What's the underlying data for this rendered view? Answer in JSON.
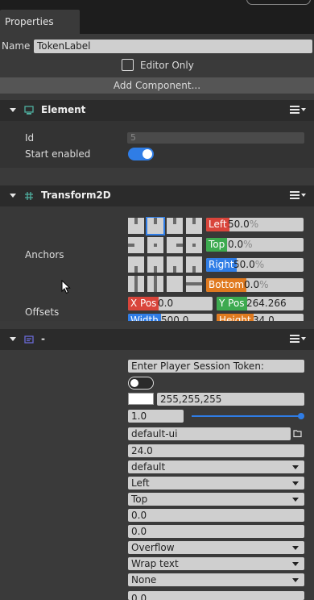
{
  "tab": {
    "label": "Properties"
  },
  "top": {
    "name_label": "Name",
    "name_value": "TokenLabel",
    "editor_only_label": "Editor Only",
    "add_component_label": "Add Component..."
  },
  "element": {
    "title": "Element",
    "id_label": "Id",
    "id_value": "5",
    "start_enabled_label": "Start enabled"
  },
  "transform": {
    "title": "Transform2D",
    "anchors_label": "Anchors",
    "offsets_label": "Offsets",
    "left_tag": "Left",
    "left_value": "50.0",
    "left_unit": "%",
    "top_tag": "Top",
    "top_value": "0.0",
    "top_unit": "%",
    "right_tag": "Right",
    "right_value": "50.0",
    "right_unit": "%",
    "bottom_tag": "Bottom",
    "bottom_value": "0.0",
    "bottom_unit": "%",
    "xpos_tag": "X Pos",
    "xpos_value": "0.0",
    "ypos_tag": "Y Pos",
    "ypos_value": "264.266",
    "width_tag": "Width",
    "width_value": "500.0",
    "height_tag": "Height",
    "height_value": "34.0"
  },
  "text_component": {
    "title": "-",
    "text_value": "Enter Player Session Token:",
    "color_value": "255,255,255",
    "opacity_value": "1.0",
    "opacity_level": 1.0,
    "font_value": "default-ui",
    "font_size_value": "24.0",
    "font_effect_value": "default",
    "h_align_value": "Left",
    "v_align_value": "Top",
    "char_spacing_value": "0.0",
    "line_spacing_value": "0.0",
    "overflow_value": "Overflow",
    "wrap_value": "Wrap text",
    "shrink_value": "None",
    "last_value": "0.0"
  },
  "colors": {
    "toggle_blue": "#2f7de6",
    "left_tag": "#d9453b",
    "top_tag": "#3daa4f",
    "right_tag": "#2f7de6",
    "bottom_tag": "#e07a1f",
    "selected_anchor": "#2f7de6"
  }
}
